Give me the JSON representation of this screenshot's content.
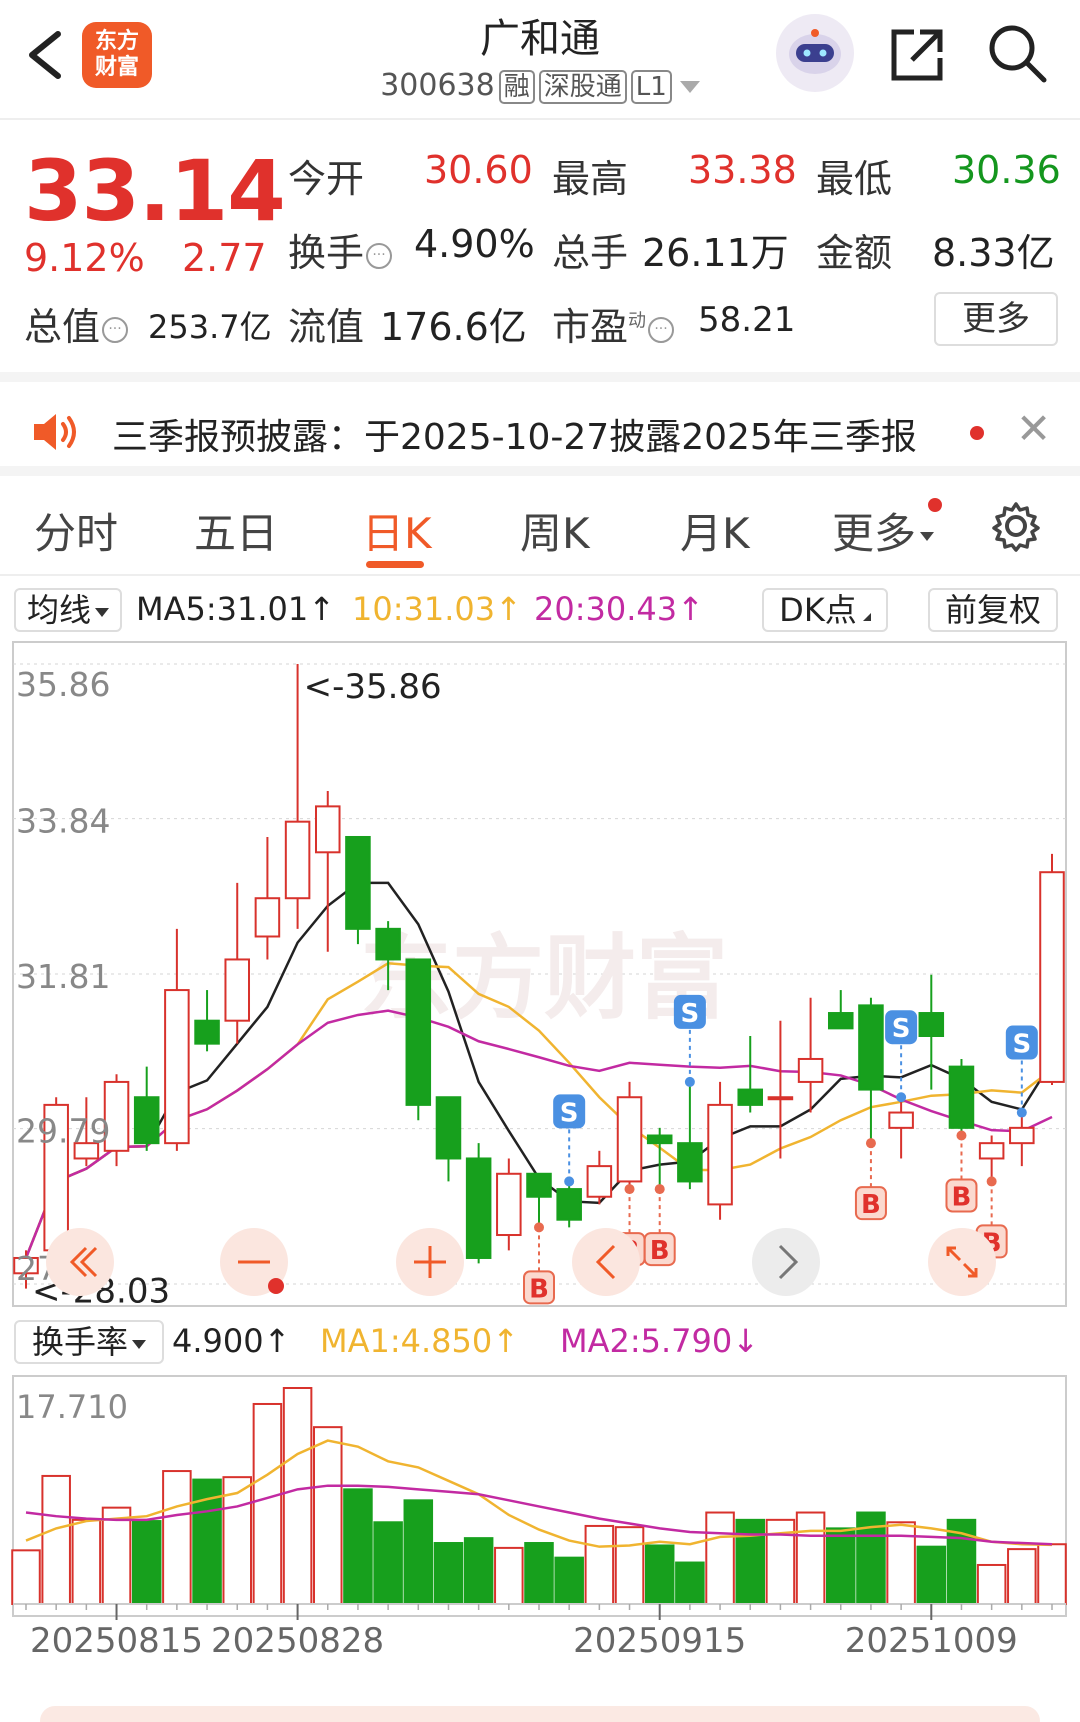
{
  "header": {
    "logo_text": "东方财富",
    "stock_name": "广和通",
    "stock_code": "300638",
    "tags": [
      "融",
      "深股通",
      "L1"
    ]
  },
  "quote": {
    "price": "33.14",
    "change_pct": "9.12%",
    "change": "2.77",
    "open_label": "今开",
    "open": "30.60",
    "high_label": "最高",
    "high": "33.38",
    "low_label": "最低",
    "low": "30.36",
    "turnover_label": "换手",
    "turnover": "4.90%",
    "volume_label": "总手",
    "volume": "26.11万",
    "amount_label": "金额",
    "amount": "8.33亿",
    "mktcap_label": "总值",
    "mktcap": "253.7亿",
    "float_label": "流值",
    "float_cap": "176.6亿",
    "pe_label": "市盈",
    "pe_sup": "动",
    "pe": "58.21",
    "more_label": "更多"
  },
  "notice": {
    "text": "三季报预披露：于2025-10-27披露2025年三季报"
  },
  "tabs": [
    "分时",
    "五日",
    "日K",
    "周K",
    "月K",
    "更多"
  ],
  "active_tab": "日K",
  "indicator_bar": {
    "selector": "均线",
    "ma5": "MA5:31.01↑",
    "ma10": "10:31.03↑",
    "ma20": "20:30.43↑",
    "dk_label": "DK点",
    "adjust_label": "前复权"
  },
  "turnover_bar": {
    "selector": "换手率",
    "value": "4.900↑",
    "ma1": "MA1:4.850↑",
    "ma2": "MA2:5.790↓"
  },
  "colors": {
    "up": "#d8322c",
    "down": "#17a01d",
    "ma5": "#222222",
    "ma10": "#f0b430",
    "ma20": "#c22aa2",
    "accent": "#f05a28",
    "signal": "#4a90e2"
  },
  "chart_data": [
    {
      "type": "candlestick",
      "y_ticks": [
        "35.86",
        "33.84",
        "31.81",
        "29.79",
        "27.76"
      ],
      "ylim": [
        27.76,
        35.86
      ],
      "max_label": "<-35.86",
      "min_label": "<-28.03",
      "x_ticks": [
        "20250815",
        "20250828",
        "20250915",
        "20251009"
      ],
      "candles": [
        [
          27.9,
          28.1,
          27.7,
          28.2
        ],
        [
          28.2,
          30.1,
          28.0,
          30.2
        ],
        [
          29.4,
          29.6,
          29.3,
          30.2
        ],
        [
          29.5,
          30.4,
          29.3,
          30.5
        ],
        [
          30.2,
          29.6,
          29.5,
          30.6
        ],
        [
          29.6,
          31.6,
          29.5,
          32.4
        ],
        [
          31.2,
          30.9,
          30.8,
          31.6
        ],
        [
          31.2,
          32.0,
          30.9,
          33.0
        ],
        [
          32.3,
          32.8,
          32.0,
          33.6
        ],
        [
          32.8,
          33.8,
          32.4,
          35.86
        ],
        [
          33.4,
          34.0,
          32.1,
          34.2
        ],
        [
          33.6,
          32.4,
          32.2,
          33.6
        ],
        [
          32.4,
          32.0,
          31.6,
          32.5
        ],
        [
          32.0,
          30.1,
          29.9,
          32.0
        ],
        [
          30.2,
          29.4,
          29.1,
          30.2
        ],
        [
          29.4,
          28.1,
          28.03,
          29.6
        ],
        [
          28.4,
          29.2,
          28.2,
          29.4
        ],
        [
          29.2,
          28.9,
          28.5,
          29.2
        ],
        [
          29.0,
          28.6,
          28.5,
          29.1
        ],
        [
          28.9,
          29.3,
          28.8,
          29.5
        ],
        [
          29.1,
          30.2,
          29.0,
          30.4
        ],
        [
          29.7,
          29.6,
          29.0,
          29.8
        ],
        [
          29.6,
          29.1,
          29.0,
          30.4
        ],
        [
          28.8,
          30.1,
          28.6,
          30.4
        ],
        [
          30.3,
          30.1,
          30.0,
          31.0
        ],
        [
          30.2,
          30.2,
          29.4,
          31.2
        ],
        [
          30.4,
          30.7,
          30.0,
          31.5
        ],
        [
          31.3,
          31.1,
          31.2,
          31.6
        ],
        [
          31.4,
          30.3,
          29.6,
          31.5
        ],
        [
          29.8,
          30.0,
          29.4,
          30.2
        ],
        [
          31.3,
          31.0,
          30.3,
          31.8
        ],
        [
          30.6,
          29.8,
          29.7,
          30.7
        ],
        [
          29.4,
          29.6,
          29.1,
          29.7
        ],
        [
          29.6,
          29.8,
          29.3,
          30.0
        ],
        [
          30.4,
          33.14,
          30.36,
          33.38
        ]
      ],
      "signals": [
        {
          "idx": 17,
          "kind": "B"
        },
        {
          "idx": 18,
          "kind": "S"
        },
        {
          "idx": 20,
          "kind": "B"
        },
        {
          "idx": 21,
          "kind": "B"
        },
        {
          "idx": 22,
          "kind": "S"
        },
        {
          "idx": 28,
          "kind": "B"
        },
        {
          "idx": 29,
          "kind": "S"
        },
        {
          "idx": 31,
          "kind": "B"
        },
        {
          "idx": 32,
          "kind": "B"
        },
        {
          "idx": 33,
          "kind": "S"
        }
      ]
    },
    {
      "type": "bar",
      "y_ticks": [
        "17.710"
      ],
      "ylim": [
        0,
        17.71
      ],
      "values": [
        4.4,
        10.5,
        6.9,
        7.9,
        6.8,
        10.9,
        10.2,
        10.4,
        16.4,
        17.71,
        14.5,
        9.4,
        6.7,
        8.5,
        5.0,
        5.4,
        4.6,
        5.0,
        3.8,
        6.4,
        6.3,
        4.8,
        3.4,
        7.5,
        6.9,
        6.9,
        7.5,
        6.2,
        7.5,
        6.7,
        4.7,
        6.9,
        3.2,
        4.5,
        4.9
      ],
      "ma1": [
        5.2,
        6.2,
        6.8,
        7.0,
        7.2,
        8.0,
        8.6,
        9.1,
        10.6,
        12.3,
        13.4,
        12.9,
        11.7,
        11.2,
        10.1,
        9.0,
        7.3,
        6.1,
        5.2,
        4.7,
        4.8,
        5.1,
        4.9,
        5.5,
        5.6,
        5.8,
        6.0,
        6.0,
        6.3,
        6.5,
        6.2,
        5.8,
        5.1,
        4.9,
        4.85
      ],
      "ma2": [
        7.5,
        7.2,
        7.0,
        6.9,
        6.9,
        7.3,
        7.6,
        8.0,
        8.7,
        9.4,
        9.7,
        9.7,
        9.6,
        9.4,
        9.2,
        9.0,
        8.5,
        8.0,
        7.5,
        7.0,
        6.6,
        6.2,
        5.9,
        5.8,
        5.7,
        5.7,
        5.6,
        5.6,
        5.6,
        5.6,
        5.5,
        5.4,
        5.1,
        5.0,
        4.9
      ]
    }
  ]
}
